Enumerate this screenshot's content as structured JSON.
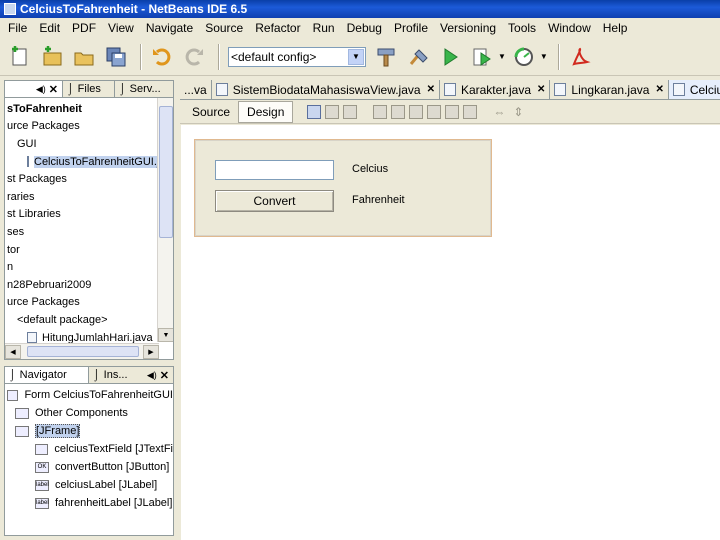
{
  "window": {
    "title": "CelciusToFahrenheit - NetBeans IDE 6.5"
  },
  "menu": [
    "File",
    "Edit",
    "PDF",
    "View",
    "Navigate",
    "Source",
    "Refactor",
    "Run",
    "Debug",
    "Profile",
    "Versioning",
    "Tools",
    "Window",
    "Help"
  ],
  "toolbar": {
    "config_value": "<default config>"
  },
  "projects_panel": {
    "tabs": [
      "",
      "Files",
      "Serv..."
    ],
    "tree": [
      {
        "label": "sToFahrenheit",
        "indent": 0,
        "bold": true
      },
      {
        "label": "urce Packages",
        "indent": 0
      },
      {
        "label": "GUI",
        "indent": 1
      },
      {
        "label": "CelciusToFahrenheitGUI.ja",
        "indent": 2,
        "selected": true
      },
      {
        "label": "st Packages",
        "indent": 0
      },
      {
        "label": "raries",
        "indent": 0
      },
      {
        "label": "st Libraries",
        "indent": 0
      },
      {
        "label": "ses",
        "indent": 0
      },
      {
        "label": "tor",
        "indent": 0
      },
      {
        "label": "n",
        "indent": 0
      },
      {
        "label": "n28Pebruari2009",
        "indent": 0
      },
      {
        "label": "urce Packages",
        "indent": 0
      },
      {
        "label": "<default package>",
        "indent": 1
      },
      {
        "label": "HitungJumlahHari.java",
        "indent": 2
      }
    ]
  },
  "navigator_panel": {
    "tabs": [
      "Navigator",
      "Ins..."
    ],
    "tree": [
      {
        "label": "Form CelciusToFahrenheitGUI",
        "indent": 0
      },
      {
        "label": "Other Components",
        "indent": 1
      },
      {
        "label": "[JFrame]",
        "indent": 1,
        "selected": true
      },
      {
        "label": "celciusTextField [JTextFi",
        "indent": 2,
        "icon": ""
      },
      {
        "label": "convertButton [JButton]",
        "indent": 2,
        "icon": "OK"
      },
      {
        "label": "celciusLabel [JLabel]",
        "indent": 2,
        "icon": "label"
      },
      {
        "label": "fahrenheitLabel [JLabel]",
        "indent": 2,
        "icon": "label"
      }
    ]
  },
  "editor": {
    "tabs": [
      {
        "label": "...va",
        "close": false,
        "active": false
      },
      {
        "label": "SistemBiodataMahasiswaView.java",
        "close": true,
        "active": false
      },
      {
        "label": "Karakter.java",
        "close": true,
        "active": false
      },
      {
        "label": "Lingkaran.java",
        "close": true,
        "active": false
      },
      {
        "label": "CelciusToF",
        "close": false,
        "active": true
      }
    ],
    "modes": {
      "source": "Source",
      "design": "Design"
    }
  },
  "form": {
    "celcius_field_value": "",
    "convert_button": "Convert",
    "celcius_label": "Celcius",
    "fahrenheit_label": "Fahrenheit"
  }
}
